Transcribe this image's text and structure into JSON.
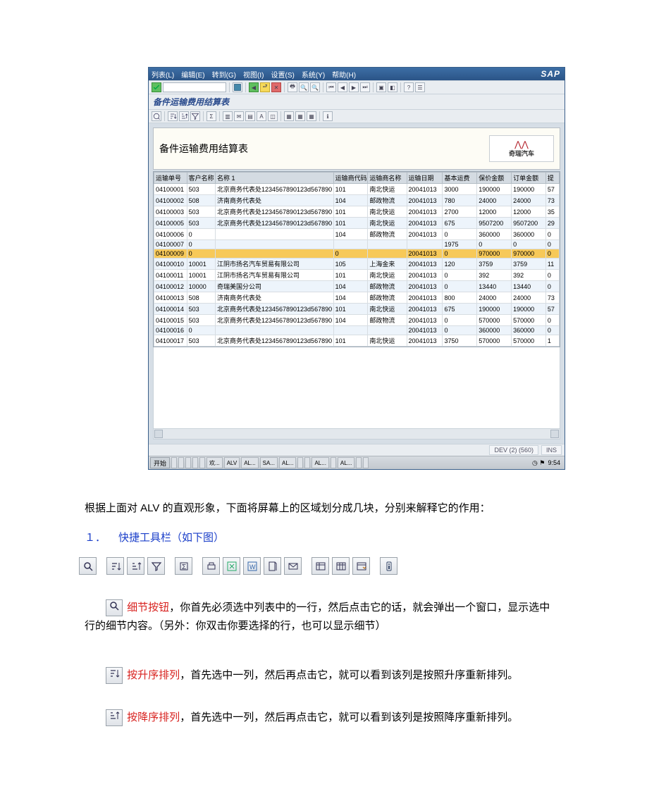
{
  "sap": {
    "menu": [
      "列表(L)",
      "编辑(E)",
      "转到(G)",
      "视图(I)",
      "设置(S)",
      "系统(Y)",
      "帮助(H)"
    ],
    "logo": "SAP",
    "title": "备件运输费用结算表",
    "panel_title": "备件运输费用结算表",
    "brand": {
      "mark": "⋀⋀",
      "name": "奇瑞汽车"
    },
    "columns": [
      "运输单号",
      "客户名称",
      "名称 1",
      "运输商代码",
      "运输商名称",
      "运输日期",
      "基本运费",
      "保价金额",
      "订单金额",
      "提"
    ],
    "rows": [
      {
        "cells": [
          "04100001",
          "503",
          "北京商务代表处1234567890123d567890",
          "101",
          "南北快运",
          "20041013",
          "3000",
          "190000",
          "190000",
          "57"
        ]
      },
      {
        "cells": [
          "04100002",
          "508",
          "济南商务代表处",
          "104",
          "邮政物流",
          "20041013",
          "780",
          "24000",
          "24000",
          "73"
        ]
      },
      {
        "cells": [
          "04100003",
          "503",
          "北京商务代表处1234567890123d567890",
          "101",
          "南北快运",
          "20041013",
          "2700",
          "12000",
          "12000",
          "35"
        ]
      },
      {
        "cells": [
          "04100005",
          "503",
          "北京商务代表处1234567890123d567890",
          "101",
          "南北快运",
          "20041013",
          "675",
          "9507200",
          "9507200",
          "29"
        ]
      },
      {
        "cells": [
          "04100006",
          "0",
          "",
          "104",
          "邮政物流",
          "20041013",
          "0",
          "360000",
          "360000",
          "0"
        ]
      },
      {
        "cells": [
          "04100007",
          "0",
          "",
          "",
          "",
          "",
          "1975",
          "0",
          "0",
          "0"
        ]
      },
      {
        "cells": [
          "04100009",
          "0",
          "",
          "0",
          "",
          "20041013",
          "0",
          "970000",
          "970000",
          "0"
        ],
        "hl": true
      },
      {
        "cells": [
          "04100010",
          "10001",
          "江阴市扬名汽车贸易有限公司",
          "105",
          "上海金来",
          "20041013",
          "120",
          "3759",
          "3759",
          "11"
        ]
      },
      {
        "cells": [
          "04100011",
          "10001",
          "江阴市扬名汽车贸易有限公司",
          "101",
          "南北快运",
          "20041013",
          "0",
          "392",
          "392",
          "0"
        ]
      },
      {
        "cells": [
          "04100012",
          "10000",
          "奇瑞美国分公司",
          "104",
          "邮政物流",
          "20041013",
          "0",
          "13440",
          "13440",
          "0"
        ]
      },
      {
        "cells": [
          "04100013",
          "508",
          "济南商务代表处",
          "104",
          "邮政物流",
          "20041013",
          "800",
          "24000",
          "24000",
          "73"
        ]
      },
      {
        "cells": [
          "04100014",
          "503",
          "北京商务代表处1234567890123d567890",
          "101",
          "南北快运",
          "20041013",
          "675",
          "190000",
          "190000",
          "57"
        ]
      },
      {
        "cells": [
          "04100015",
          "503",
          "北京商务代表处1234567890123d567890",
          "104",
          "邮政物流",
          "20041013",
          "0",
          "570000",
          "570000",
          "0"
        ]
      },
      {
        "cells": [
          "04100016",
          "0",
          "",
          "",
          "",
          "20041013",
          "0",
          "360000",
          "360000",
          "0"
        ]
      },
      {
        "cells": [
          "04100017",
          "503",
          "北京商务代表处1234567890123d567890",
          "101",
          "南北快运",
          "20041013",
          "3750",
          "570000",
          "570000",
          "1"
        ]
      }
    ],
    "status": "DEV (2) (560)",
    "taskbar": {
      "start": "开始",
      "items": [
        "",
        "",
        "",
        "",
        "",
        "欢...",
        "ALV",
        "AL...",
        "SA...",
        "AL...",
        "",
        "",
        "AL...",
        "",
        "AL...",
        "",
        ""
      ],
      "clock": "9:54"
    }
  },
  "doc": {
    "intro": "根据上面对 ALV 的直观形象，下面将屏幕上的区域划分成几块，分别来解释它的作用：",
    "section1_num": "１．",
    "section1_title": "快捷工具栏（如下图）",
    "detail": {
      "label": "细节按钮",
      "text1": "，你首先必须选中列表中的一行，然后点击它的话，就会弹出一个窗口，显示选中",
      "text2": "行的细节内容。（另外：你双击你要选择的行，也可以显示细节）"
    },
    "asc": {
      "label": "按升序排列",
      "text": "，首先选中一列，然后再点击它，就可以看到该列是按照升序重新排列。"
    },
    "desc": {
      "label": "按降序排列",
      "text": "，首先选中一列，然后再点击它，就可以看到该列是按照降序重新排列。"
    }
  }
}
